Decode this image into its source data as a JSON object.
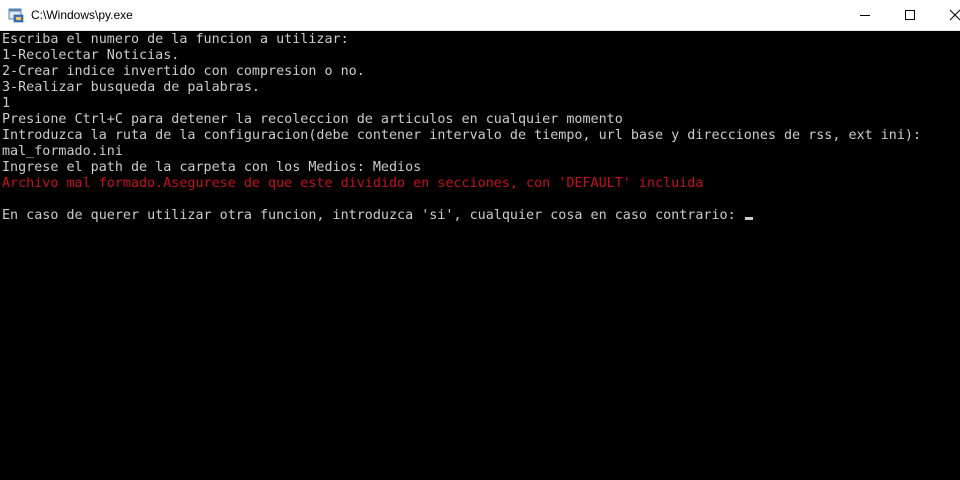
{
  "window": {
    "title": "C:\\Windows\\py.exe",
    "icon": "python-launcher-icon"
  },
  "controls": {
    "minimize_icon": "minimize-icon",
    "maximize_icon": "maximize-icon",
    "close_icon": "close-icon"
  },
  "console": {
    "lines": [
      {
        "text": "Escriba el numero de la funcion a utilizar:",
        "type": "normal"
      },
      {
        "text": "1-Recolectar Noticias.",
        "type": "normal"
      },
      {
        "text": "2-Crear indice invertido con compresion o no.",
        "type": "normal"
      },
      {
        "text": "3-Realizar busqueda de palabras.",
        "type": "normal"
      },
      {
        "text": "1",
        "type": "normal"
      },
      {
        "text": "Presione Ctrl+C para detener la recoleccion de articulos en cualquier momento",
        "type": "normal"
      },
      {
        "text": "Introduzca la ruta de la configuracion(debe contener intervalo de tiempo, url base y direcciones de rss, ext ini):",
        "type": "normal"
      },
      {
        "text": "mal_formado.ini",
        "type": "normal"
      },
      {
        "text": "Ingrese el path de la carpeta con los Medios: Medios",
        "type": "normal"
      },
      {
        "text": "Archivo mal formado.Asegurese de que este dividido en secciones, con 'DEFAULT' incluida",
        "type": "error"
      },
      {
        "text": "",
        "type": "normal"
      },
      {
        "text": "En caso de querer utilizar otra funcion, introduzca 'si', cualquier cosa en caso contrario: ",
        "type": "prompt"
      }
    ]
  },
  "colors": {
    "background": "#000000",
    "text": "#cccccc",
    "error": "#c50f1f"
  }
}
